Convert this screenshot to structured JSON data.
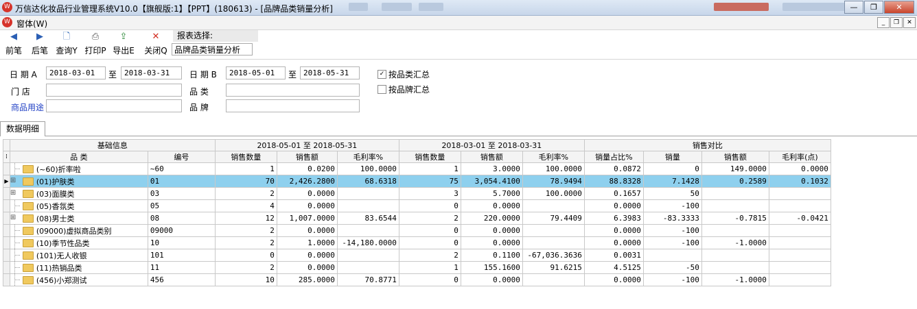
{
  "window": {
    "title": "万信达化妆品行业管理系统V10.0【旗舰版:1】【PPT】(180613) - [品牌品类销量分析]"
  },
  "menu": {
    "label": "窗体(W)"
  },
  "toolbar": {
    "buttons": [
      {
        "label": "前笔",
        "icon": "◀"
      },
      {
        "label": "后笔",
        "icon": "▶"
      },
      {
        "label": "查询Y",
        "icon": "🗋"
      },
      {
        "label": "打印P",
        "icon": "⎙"
      },
      {
        "label": "导出E",
        "icon": "⇪"
      },
      {
        "label": "关闭Q",
        "icon": "✕"
      }
    ],
    "report_select_label": "报表选择:",
    "report_select_value": "品牌品类销量分析"
  },
  "filters": {
    "date_a_label": "日 期 A",
    "date_a_from": "2018-03-01",
    "to_label_1": "至",
    "date_a_to": "2018-03-31",
    "date_b_label": "日 期 B",
    "date_b_from": "2018-05-01",
    "to_label_2": "至",
    "date_b_to": "2018-05-31",
    "store_label": "门    店",
    "category_label": "品    类",
    "usage_label": "商品用途",
    "brand_label": "品    牌",
    "by_category": "按品类汇总",
    "by_brand": "按品牌汇总"
  },
  "tab": {
    "label": "数据明细"
  },
  "grid": {
    "group_headers": [
      "基础信息",
      "2018-05-01 至 2018-05-31",
      "2018-03-01 至 2018-03-31",
      "销售对比"
    ],
    "columns": [
      "品    类",
      "编号",
      "销售数量",
      "销售额",
      "毛利率%",
      "销售数量",
      "销售额",
      "毛利率%",
      "销量占比%",
      "销量",
      "销售额",
      "毛利率(点)"
    ],
    "rows": [
      {
        "name": "(~60)折率啦",
        "code": "~60",
        "b_qty": "1",
        "b_amt": "0.0200",
        "b_gm": "100.0000",
        "a_qty": "1",
        "a_amt": "3.0000",
        "a_gm": "100.0000",
        "share": "0.0872",
        "d_qty": "0",
        "d_amt": "149.0000",
        "d_gm": "0.0000",
        "expandable": false,
        "selected": false
      },
      {
        "name": "(01)护肤类",
        "code": "01",
        "b_qty": "70",
        "b_amt": "2,426.2800",
        "b_gm": "68.6318",
        "a_qty": "75",
        "a_amt": "3,054.4100",
        "a_gm": "78.9494",
        "share": "88.8328",
        "d_qty": "7.1428",
        "d_amt": "0.2589",
        "d_gm": "0.1032",
        "expandable": true,
        "selected": true
      },
      {
        "name": "(03)面膜类",
        "code": "03",
        "b_qty": "2",
        "b_amt": "0.0000",
        "b_gm": "",
        "a_qty": "3",
        "a_amt": "5.7000",
        "a_gm": "100.0000",
        "share": "0.1657",
        "d_qty": "50",
        "d_amt": "",
        "d_gm": "",
        "expandable": true,
        "selected": false
      },
      {
        "name": "(05)香氛类",
        "code": "05",
        "b_qty": "4",
        "b_amt": "0.0000",
        "b_gm": "",
        "a_qty": "0",
        "a_amt": "0.0000",
        "a_gm": "",
        "share": "0.0000",
        "d_qty": "-100",
        "d_amt": "",
        "d_gm": "",
        "expandable": false,
        "selected": false
      },
      {
        "name": "(08)男士类",
        "code": "08",
        "b_qty": "12",
        "b_amt": "1,007.0000",
        "b_gm": "83.6544",
        "a_qty": "2",
        "a_amt": "220.0000",
        "a_gm": "79.4409",
        "share": "6.3983",
        "d_qty": "-83.3333",
        "d_amt": "-0.7815",
        "d_gm": "-0.0421",
        "expandable": true,
        "selected": false
      },
      {
        "name": "(09000)虚拟商品类别",
        "code": "09000",
        "b_qty": "2",
        "b_amt": "0.0000",
        "b_gm": "",
        "a_qty": "0",
        "a_amt": "0.0000",
        "a_gm": "",
        "share": "0.0000",
        "d_qty": "-100",
        "d_amt": "",
        "d_gm": "",
        "expandable": false,
        "selected": false
      },
      {
        "name": "(10)季节性品类",
        "code": "10",
        "b_qty": "2",
        "b_amt": "1.0000",
        "b_gm": "-14,180.0000",
        "a_qty": "0",
        "a_amt": "0.0000",
        "a_gm": "",
        "share": "0.0000",
        "d_qty": "-100",
        "d_amt": "-1.0000",
        "d_gm": "",
        "expandable": false,
        "selected": false
      },
      {
        "name": "(101)无人收银",
        "code": "101",
        "b_qty": "0",
        "b_amt": "0.0000",
        "b_gm": "",
        "a_qty": "2",
        "a_amt": "0.1100",
        "a_gm": "-67,036.3636",
        "share": "0.0031",
        "d_qty": "",
        "d_amt": "",
        "d_gm": "",
        "expandable": false,
        "selected": false
      },
      {
        "name": "(11)热销品类",
        "code": "11",
        "b_qty": "2",
        "b_amt": "0.0000",
        "b_gm": "",
        "a_qty": "1",
        "a_amt": "155.1600",
        "a_gm": "91.6215",
        "share": "4.5125",
        "d_qty": "-50",
        "d_amt": "",
        "d_gm": "",
        "expandable": false,
        "selected": false
      },
      {
        "name": "(456)小郑测试",
        "code": "456",
        "b_qty": "10",
        "b_amt": "285.0000",
        "b_gm": "70.8771",
        "a_qty": "0",
        "a_amt": "0.0000",
        "a_gm": "",
        "share": "0.0000",
        "d_qty": "-100",
        "d_amt": "-1.0000",
        "d_gm": "",
        "expandable": false,
        "selected": false
      }
    ]
  }
}
